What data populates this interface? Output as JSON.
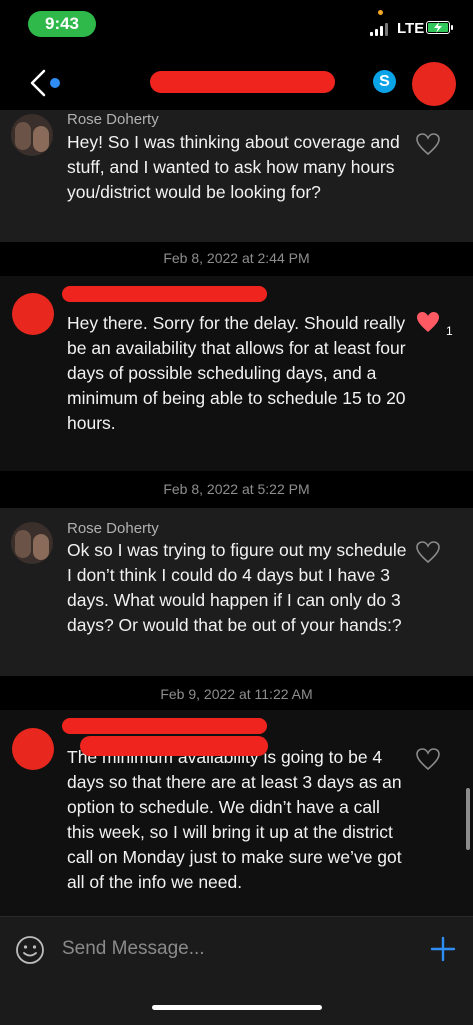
{
  "status_bar": {
    "time": "9:43",
    "network": "LTE"
  },
  "header": {
    "skype_glyph": "S"
  },
  "messages": [
    {
      "sender": "Rose Doherty",
      "text": "Hey! So I was thinking about coverage and stuff, and I wanted to ask how many hours you/district would be looking for?"
    },
    {
      "date": "Feb 8, 2022 at 2:44 PM",
      "text": "Hey there. Sorry for the delay. Should really be an availability that allows for at least four days of possible scheduling days, and a minimum of being able to schedule 15 to 20 hours.",
      "like_count": "1"
    },
    {
      "date": "Feb 8, 2022 at 5:22 PM",
      "sender": "Rose Doherty",
      "text": "Ok so I was trying to figure out my schedule I don’t think I could do 4 days but I have 3 days. What would happen if I can only do 3 days? Or would that be out of your hands:?"
    },
    {
      "date": "Feb 9, 2022 at 11:22 AM",
      "text": "The minimum availability is going to be 4 days so that there are at least 3 days as an option to schedule. We didn’t have a call this week, so I will bring it up at the district call on Monday just to make sure we’ve got all of the info we need."
    }
  ],
  "composer": {
    "placeholder": "Send Message..."
  },
  "icons": {
    "back": "chevron-left-icon",
    "skype": "skype-icon",
    "heart": "heart-icon",
    "emoji": "smiley-icon",
    "add": "plus-icon"
  },
  "colors": {
    "accent": "#2f8ef5",
    "like": "#ff5a64",
    "status_green": "#2fb94b",
    "redaction": "#f0241f"
  }
}
